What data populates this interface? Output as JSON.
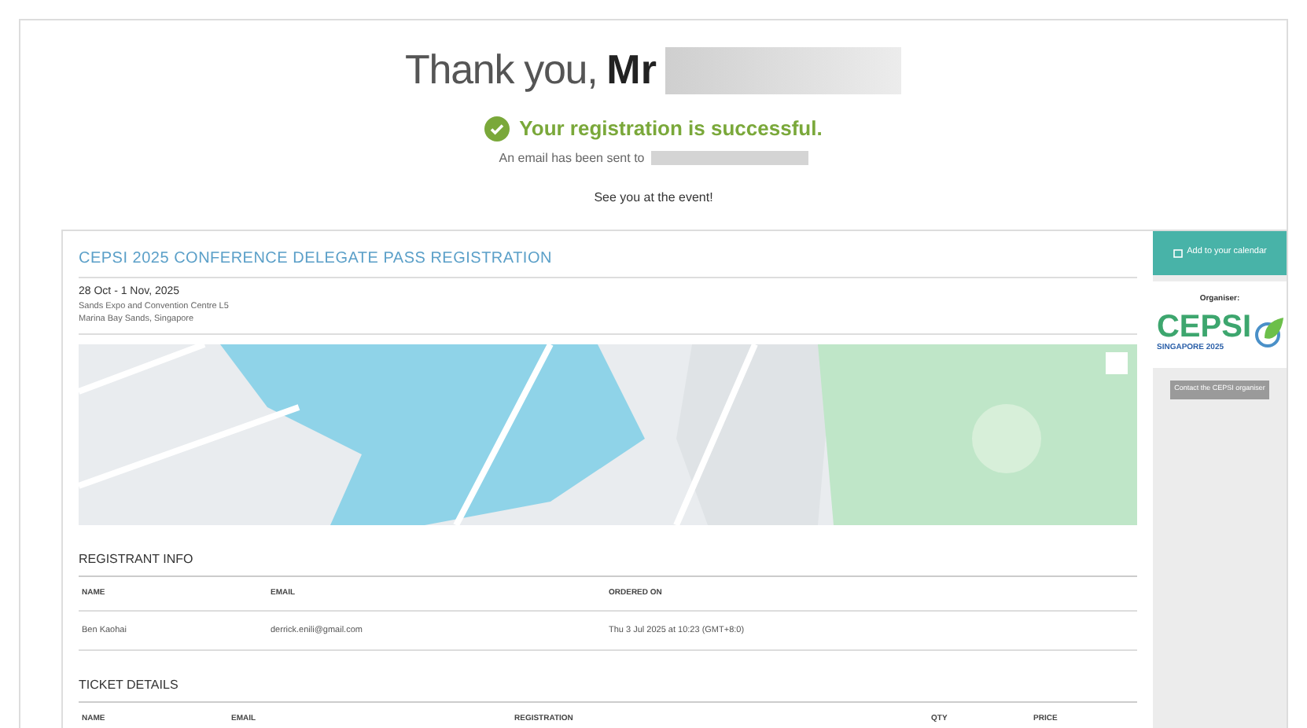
{
  "header": {
    "greeting": "Thank you,",
    "salutation": "Mr",
    "success": "Your registration is successful.",
    "email_note": "An email has been sent to",
    "closing": "See you at the event!"
  },
  "event": {
    "title": "CEPSI 2025 CONFERENCE DELEGATE PASS REGISTRATION",
    "dates": "28 Oct - 1 Nov, 2025",
    "venue_lines": [
      "Sands Expo and Convention Centre L5",
      "Marina Bay Sands, Singapore"
    ]
  },
  "sidebar": {
    "calendar_button": "Add to your calendar",
    "organizer_label": "Organiser:",
    "logo_text": "CEPSI",
    "logo_subtext": "SINGAPORE 2025",
    "contact_button": "Contact the CEPSI organiser"
  },
  "registrant_info": {
    "title": "REGISTRANT INFO",
    "columns": [
      "NAME",
      "EMAIL",
      "ORDERED ON"
    ],
    "rows": [
      [
        "Ben Kaohai",
        "derrick.enili@gmail.com",
        "Thu 3 Jul 2025 at 10:23 (GMT+8:0)"
      ]
    ]
  },
  "ticket_details": {
    "title": "TICKET DETAILS",
    "columns": [
      "NAME",
      "EMAIL",
      "REGISTRATION",
      "QTY",
      "PRICE"
    ]
  }
}
